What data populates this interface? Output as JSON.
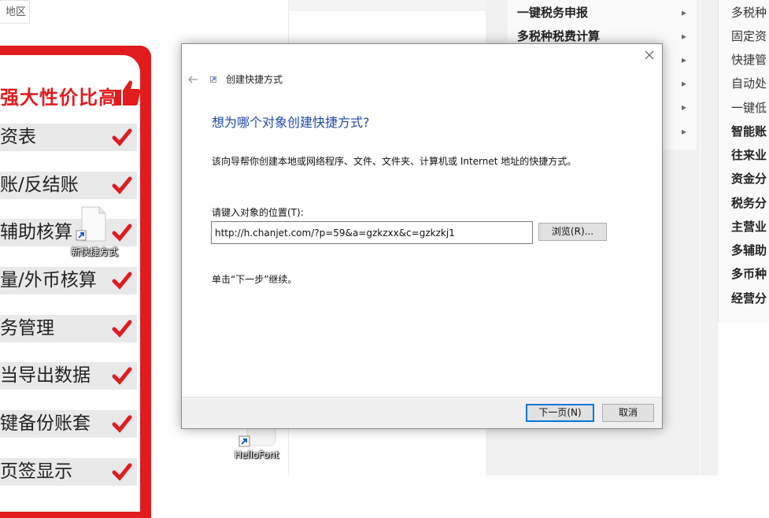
{
  "background": {
    "region_label": "地区",
    "promo": {
      "headline": "强大性价比高",
      "features": [
        "资表",
        "账/反结账",
        "辅助核算",
        "量/外币核算",
        "务管理",
        "当导出数据",
        "键备份账套",
        "页签显示"
      ]
    },
    "menu": {
      "items": [
        "一键税务申报",
        "多税种税费计算",
        "",
        "",
        "",
        ""
      ]
    },
    "right_list": [
      {
        "label": "多税种",
        "bold": false
      },
      {
        "label": "固定资",
        "bold": false
      },
      {
        "label": "快捷管",
        "bold": false
      },
      {
        "label": "自动处",
        "bold": false
      },
      {
        "label": "一键低",
        "bold": false
      },
      {
        "label": "智能账",
        "bold": true
      },
      {
        "label": "往来业",
        "bold": true
      },
      {
        "label": "资金分",
        "bold": true
      },
      {
        "label": "税务分",
        "bold": true
      },
      {
        "label": "主营业",
        "bold": true
      },
      {
        "label": "多辅助",
        "bold": true
      },
      {
        "label": "多币种",
        "bold": true
      },
      {
        "label": "经营分",
        "bold": true
      }
    ]
  },
  "desktop_icons": {
    "new_shortcut": "新快捷方式",
    "hellofont": "HelloFont"
  },
  "dialog": {
    "title": "创建快捷方式",
    "heading": "想为哪个对象创建快捷方式?",
    "description": "该向导帮你创建本地或网络程序、文件、文件夹、计算机或 Internet 地址的快捷方式。",
    "location_label": "请键入对象的位置(T):",
    "location_value": "http://h.chanjet.com/?p=59&a=gzkzxx&c=gzkzkj1",
    "browse_label": "浏览(R)...",
    "instruction": "单击“下一步”继续。",
    "next_label": "下一页(N)",
    "cancel_label": "取消"
  },
  "colors": {
    "promo_red": "#e01c1f",
    "heading_blue": "#1e4aa8",
    "default_button_border": "#0078d7"
  }
}
